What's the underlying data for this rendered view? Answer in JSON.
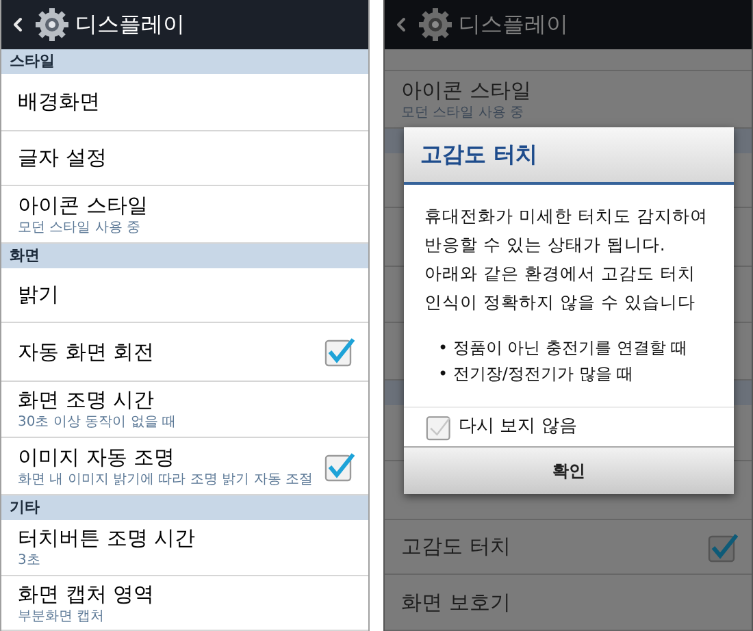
{
  "screens": [
    {
      "header": {
        "title": "디스플레이"
      },
      "sections": [
        {
          "title": "스타일",
          "items": [
            {
              "kind": "plain",
              "title": "배경화면"
            },
            {
              "kind": "plain",
              "title": "글자 설정"
            },
            {
              "kind": "plain",
              "title": "아이콘 스타일",
              "summary": "모던 스타일 사용 중"
            }
          ]
        },
        {
          "title": "화면",
          "items": [
            {
              "kind": "plain",
              "title": "밝기"
            },
            {
              "kind": "checkbox",
              "title": "자동 화면 회전",
              "checked": true
            },
            {
              "kind": "plain",
              "title": "화면 조명 시간",
              "summary": "30초 이상 동작이 없을 때"
            },
            {
              "kind": "checkbox",
              "title": "이미지 자동 조명",
              "summary": "화면 내 이미지 밝기에 따라 조명 밝기 자동 조절",
              "checked": true
            }
          ]
        },
        {
          "title": "기타",
          "items": [
            {
              "kind": "plain",
              "title": "터치버튼 조명 시간",
              "summary": "3초"
            },
            {
              "kind": "plain",
              "title": "화면 캡처 영역",
              "summary": "부분화면 캡처"
            }
          ]
        }
      ]
    },
    {
      "header": {
        "title": "디스플레이"
      },
      "top_items": [
        {
          "kind": "plain",
          "title": "아이콘 스타일",
          "summary": "모던 스타일 사용 중"
        }
      ],
      "bottom_items": [
        {
          "kind": "checkbox",
          "title": "고감도 터치",
          "checked": true
        },
        {
          "kind": "plain",
          "title": "화면 보호기"
        }
      ],
      "dialog": {
        "title": "고감도 터치",
        "message": "휴대전화가 미세한 터치도 감지하여\n반응할 수 있는 상태가 됩니다.\n아래와 같은 환경에서 고감도 터치\n인식이 정확하지 않을 수 있습니다",
        "bullets": [
          "• 정품이 아닌 충전기를 연결할 때",
          "• 전기장/정전기가 많을 때"
        ],
        "checkbox": {
          "label": "다시 보지 않음",
          "checked": false
        },
        "button": "확인"
      }
    }
  ]
}
